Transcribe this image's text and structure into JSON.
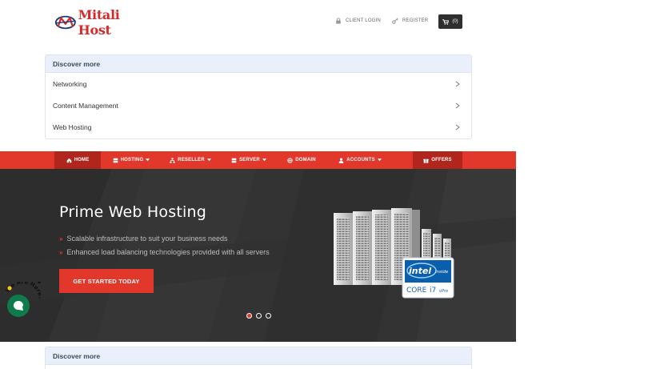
{
  "header": {
    "logo_text": "Mitali Host",
    "client_login": "CLIENT LOGIN",
    "register": "REGISTER",
    "cart_count": "(0)"
  },
  "discover_top": {
    "title": "Discover more",
    "items": [
      "Networking",
      "Content Management",
      "Web Hosting"
    ]
  },
  "nav": {
    "items": [
      {
        "label": "HOME",
        "icon": "home-icon"
      },
      {
        "label": "HOSTING",
        "icon": "server-icon"
      },
      {
        "label": "RESELLER",
        "icon": "sitemap-icon"
      },
      {
        "label": "SERVER",
        "icon": "server-icon"
      },
      {
        "label": "DOMAIN",
        "icon": "globe-icon"
      },
      {
        "label": "ACCOUNTS",
        "icon": "user-icon"
      },
      {
        "label": "OFFERS",
        "icon": "gift-icon"
      }
    ]
  },
  "hero": {
    "title": "Prime Web Hosting",
    "bullets": [
      "Scalable infrastructure to suit your business needs",
      "Enhanced load balancing technologies provided with all servers"
    ],
    "cta": "GET STARTED TODAY",
    "intel_brand": "intel",
    "intel_inside": "inside",
    "intel_core": "CORE",
    "intel_model": "i7",
    "intel_vpro": "vPro"
  },
  "discover_bottom": {
    "title": "Discover more"
  },
  "chat": {
    "badge_text": "We Are Here!"
  },
  "colors": {
    "accent": "#e2382c",
    "accent_dark": "#b0261d",
    "hero_bg": "#333333",
    "chat": "#0f7a4c"
  }
}
